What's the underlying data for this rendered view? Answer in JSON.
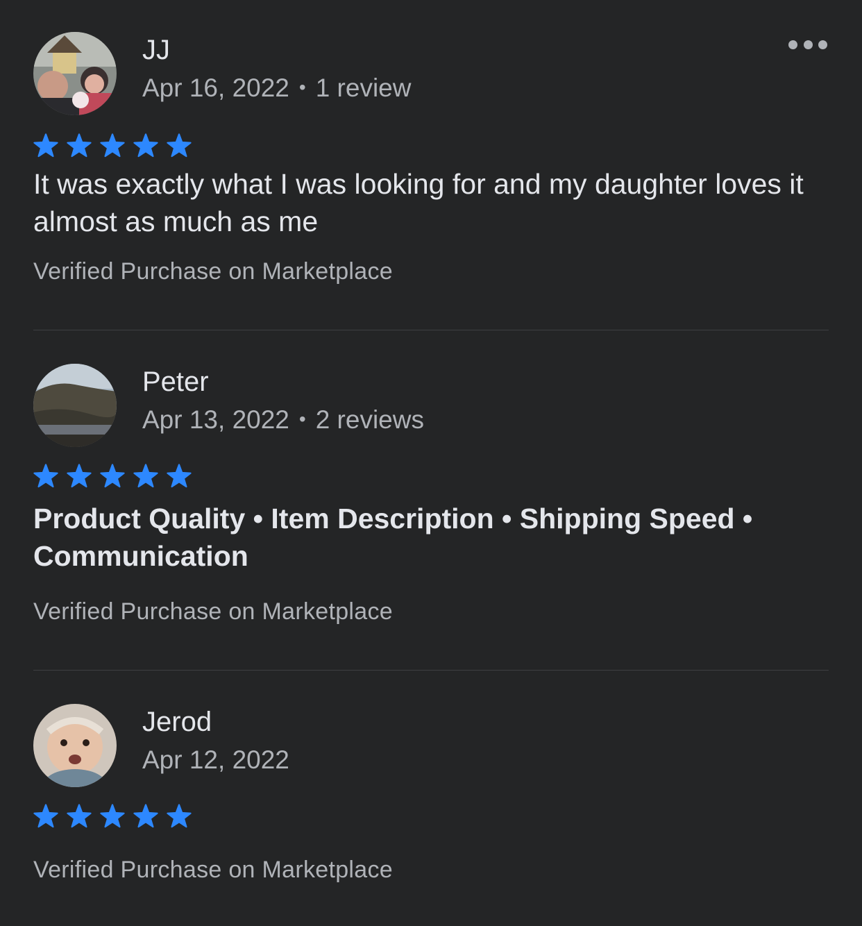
{
  "colors": {
    "background": "#242526",
    "primary_text": "#e4e6eb",
    "secondary_text": "#b0b3b8",
    "star": "#2d88ff",
    "divider": "#3e4042"
  },
  "more_menu_icon": "more-horizontal-icon",
  "reviews": [
    {
      "name": "JJ",
      "date": "Apr 16, 2022",
      "separator": "•",
      "review_count": "1 review",
      "rating": 5,
      "text": "It was exactly what I was looking for and my daughter loves it almost as much as me",
      "verified": "Verified Purchase on Marketplace"
    },
    {
      "name": "Peter",
      "date": "Apr 13, 2022",
      "separator": "•",
      "review_count": "2 reviews",
      "rating": 5,
      "tags": "Product Quality • Item Description • Shipping Speed • Communication",
      "verified": "Verified Purchase on Marketplace"
    },
    {
      "name": "Jerod",
      "date": "Apr 12, 2022",
      "rating": 5,
      "verified": "Verified Purchase on Marketplace"
    }
  ]
}
